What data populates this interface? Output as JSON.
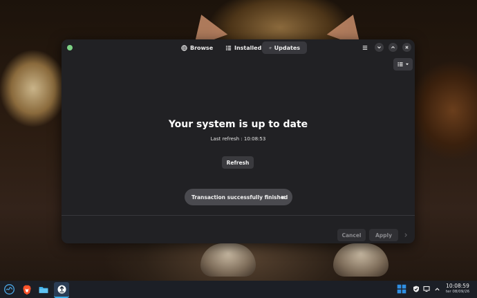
{
  "tabs": [
    {
      "label": "Browse",
      "icon": "globe-icon"
    },
    {
      "label": "Installed",
      "icon": "list-icon"
    },
    {
      "label": "Updates",
      "icon": "refresh-icon",
      "active": true
    }
  ],
  "main": {
    "title": "Your system is up to date",
    "last_refresh": "Last refresh : 10:08:53",
    "refresh_label": "Refresh"
  },
  "toast": {
    "message": "Transaction successfully finished"
  },
  "footer": {
    "cancel_label": "Cancel",
    "apply_label": "Apply"
  },
  "taskbar": {
    "time": "10:08:59",
    "date": "ter 08/09/26",
    "launchers": [
      "start-menu-icon",
      "brave-browser-icon",
      "file-manager-icon",
      "software-updater-icon"
    ],
    "tray": [
      "dropbox-icon",
      "shield-icon",
      "display-icon",
      "chevron-up-icon"
    ]
  },
  "colors": {
    "accent_dot": "#7dd185",
    "window_bg": "#212124",
    "taskbar_bg": "#1c1f26"
  }
}
